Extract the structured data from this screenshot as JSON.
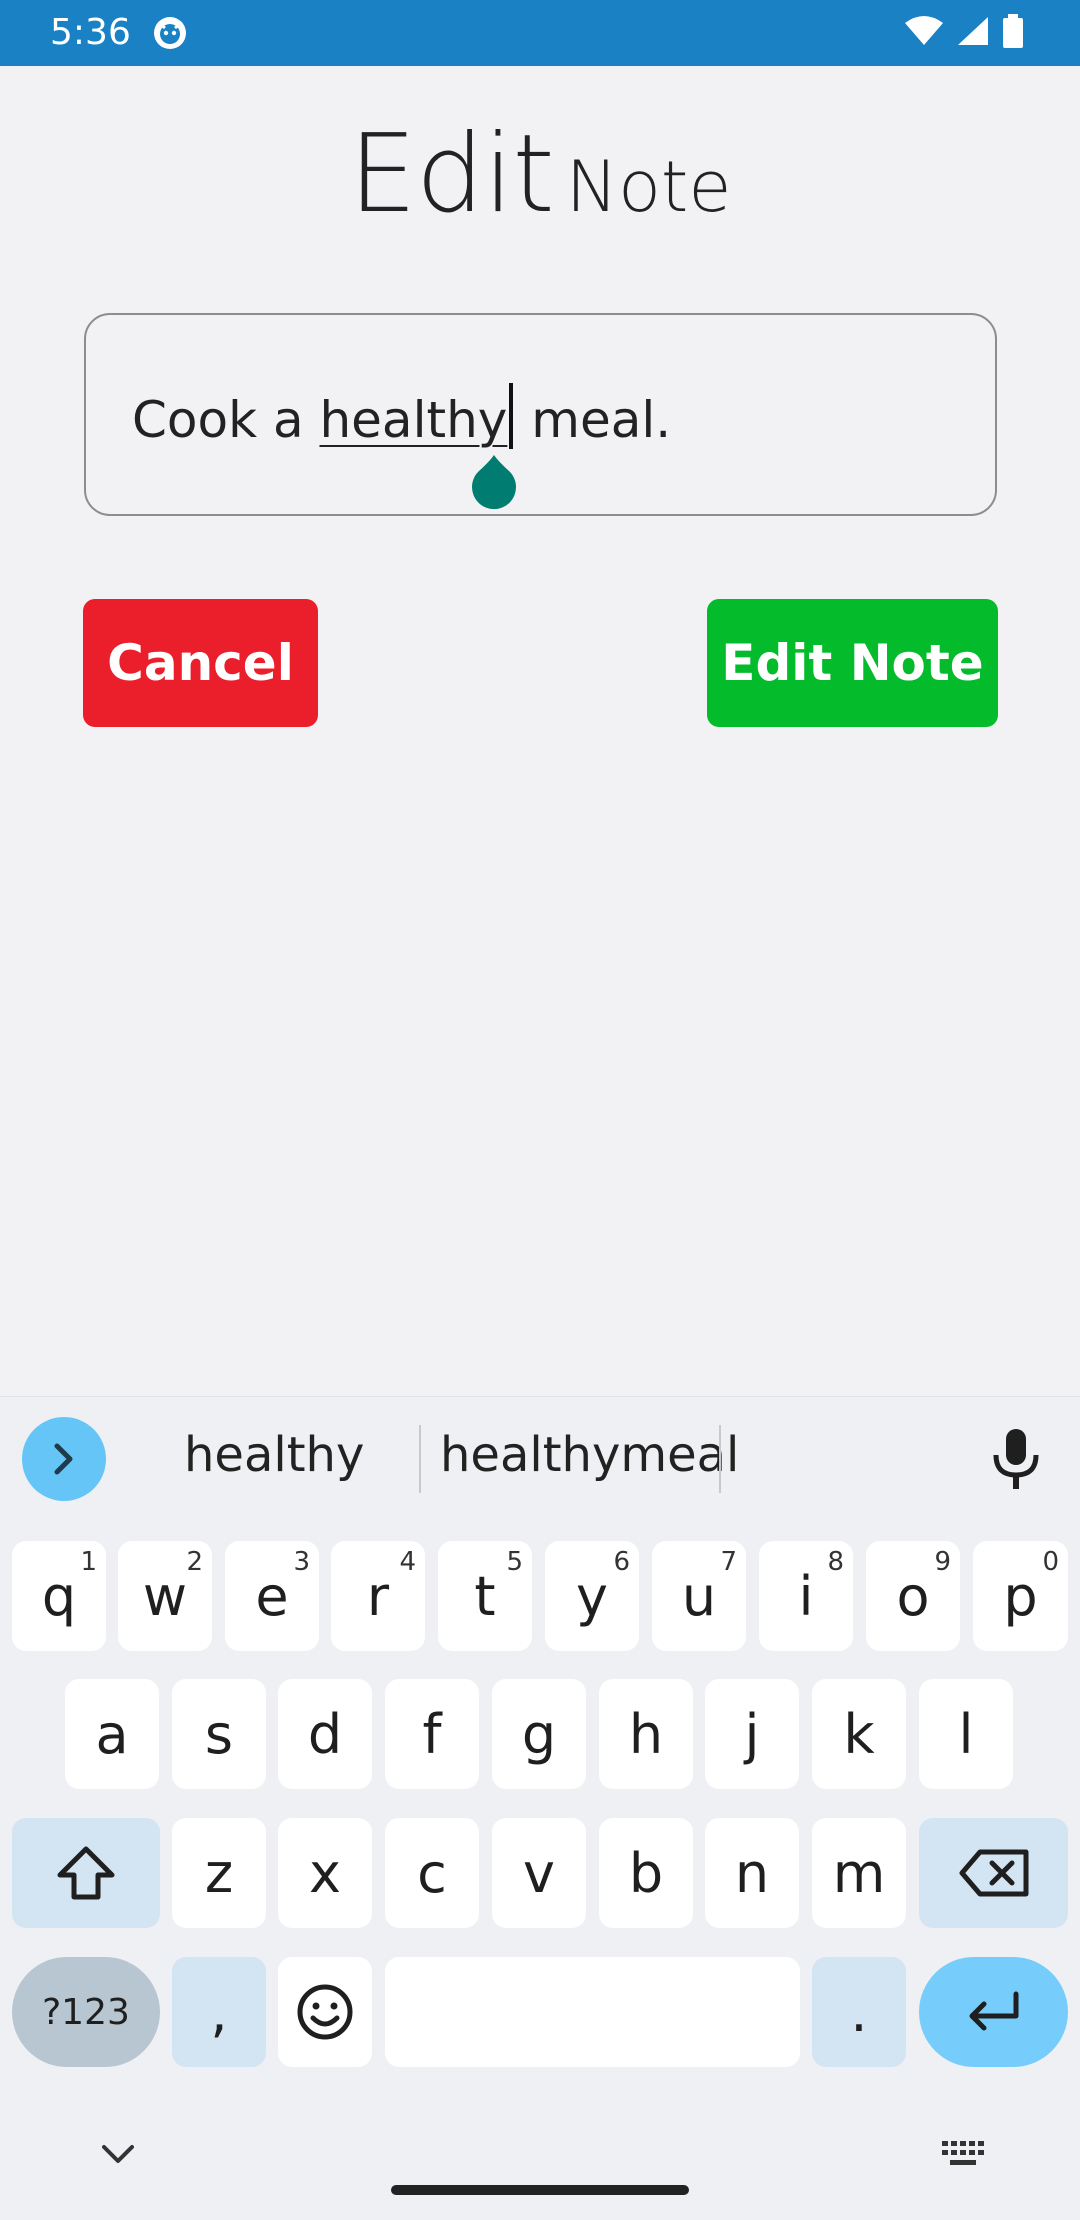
{
  "status_bar": {
    "time": "5:36",
    "bg_color": "#1a82c4"
  },
  "page": {
    "title_main": "Edit",
    "title_sub": "Note"
  },
  "note_input": {
    "text_before": "Cook a ",
    "underlined_word": "healthy",
    "text_after": " meal.",
    "handle_color": "#007c70"
  },
  "buttons": {
    "cancel_label": "Cancel",
    "edit_label": "Edit Note",
    "cancel_color": "#eb1f2b",
    "edit_color": "#03bb2b"
  },
  "keyboard": {
    "suggestions": [
      "healthy",
      "healthymeal"
    ],
    "row1": [
      {
        "key": "q",
        "hint": "1"
      },
      {
        "key": "w",
        "hint": "2"
      },
      {
        "key": "e",
        "hint": "3"
      },
      {
        "key": "r",
        "hint": "4"
      },
      {
        "key": "t",
        "hint": "5"
      },
      {
        "key": "y",
        "hint": "6"
      },
      {
        "key": "u",
        "hint": "7"
      },
      {
        "key": "i",
        "hint": "8"
      },
      {
        "key": "o",
        "hint": "9"
      },
      {
        "key": "p",
        "hint": "0"
      }
    ],
    "row2": [
      "a",
      "s",
      "d",
      "f",
      "g",
      "h",
      "j",
      "k",
      "l"
    ],
    "row3": [
      "z",
      "x",
      "c",
      "v",
      "b",
      "n",
      "m"
    ],
    "symbols_label": "?123",
    "comma_label": ",",
    "period_label": "."
  }
}
